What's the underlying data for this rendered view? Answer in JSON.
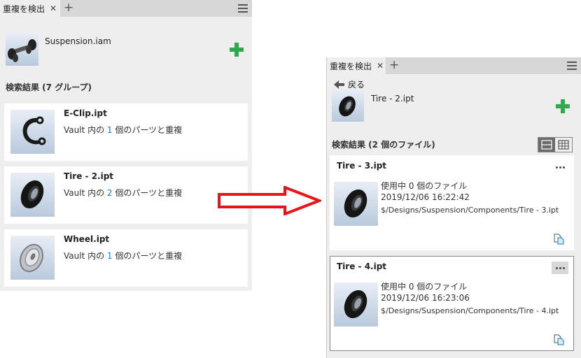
{
  "left_panel": {
    "tab_label": "重複を検出",
    "source_file": "Suspension.iam",
    "results_title": "検索結果 (7 グループ)",
    "groups": [
      {
        "title": "E-Clip.ipt",
        "prefix": "Vault 内の ",
        "count": "1",
        "suffix": " 個のパーツと重複",
        "icon": "e-clip-icon"
      },
      {
        "title": "Tire - 2.ipt",
        "prefix": "Vault 内の ",
        "count": "2",
        "suffix": " 個のパーツと重複",
        "icon": "tire-icon"
      },
      {
        "title": "Wheel.ipt",
        "prefix": "Vault 内の ",
        "count": "1",
        "suffix": " 個のパーツと重複",
        "icon": "wheel-icon"
      }
    ]
  },
  "right_panel": {
    "tab_label": "重複を検出",
    "back_label": "戻る",
    "source_file": "Tire - 2.ipt",
    "results_title": "検索結果 (2 個のファイル)",
    "files": [
      {
        "title": "Tire - 3.ipt",
        "usage": "使用中 0 個のファイル",
        "date": "2019/12/06 16:22:42",
        "path": "$/Designs/Suspension/Components/Tire - 3.ipt",
        "selected": false
      },
      {
        "title": "Tire - 4.ipt",
        "usage": "使用中 0 個のファイル",
        "date": "2019/12/06 16:23:06",
        "path": "$/Designs/Suspension/Components/Tire - 4.ipt",
        "selected": true
      }
    ]
  },
  "colors": {
    "accent_plus": "#2fa84f",
    "arrow": "#e8141b",
    "count_blue": "#1a79c2"
  },
  "icons": {
    "close": "close-icon",
    "add_tab": "plus-icon",
    "menu": "hamburger-icon",
    "back": "arrow-left-icon",
    "more": "ellipsis-icon",
    "doc": "document-icon"
  }
}
